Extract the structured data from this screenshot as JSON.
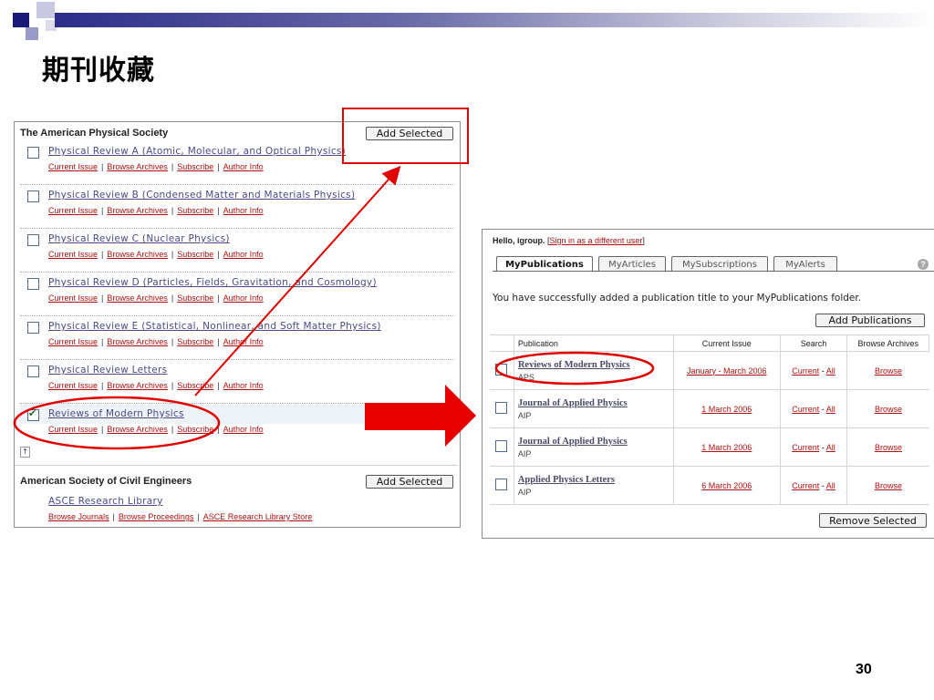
{
  "slide": {
    "title": "期刊收藏",
    "page_number": "30"
  },
  "left": {
    "society1": "The American Physical Society",
    "add_selected": "Add Selected",
    "journals": [
      {
        "title": "Physical Review A (Atomic, Molecular, and Optical Physics)",
        "checked": false
      },
      {
        "title": "Physical Review B (Condensed Matter and Materials Physics)",
        "checked": false
      },
      {
        "title": "Physical Review C (Nuclear Physics)",
        "checked": false
      },
      {
        "title": "Physical Review D (Particles, Fields, Gravitation, and Cosmology)",
        "checked": false
      },
      {
        "title": "Physical Review E (Statistical, Nonlinear, and Soft Matter Physics)",
        "checked": false
      },
      {
        "title": "Physical Review Letters",
        "checked": false
      },
      {
        "title": "Reviews of Modern Physics",
        "checked": true
      }
    ],
    "links": {
      "current": "Current Issue",
      "browse": "Browse Archives",
      "subscribe": "Subscribe",
      "author": "Author Info"
    },
    "top_icon": "up-arrow-icon",
    "society2": "American Society of Civil Engineers",
    "asce_title": "ASCE Research Library",
    "asce_links": {
      "journals": "Browse Journals",
      "proceedings": "Browse Proceedings",
      "store": "ASCE Research Library Store"
    }
  },
  "right": {
    "hello_prefix": "Hello, igroup.",
    "sign_in": "Sign in as a different user",
    "tabs": [
      "MyPublications",
      "MyArticles",
      "MySubscriptions",
      "MyAlerts"
    ],
    "message": "You have successfully added a publication title to your MyPublications folder.",
    "add_publications": "Add Publications",
    "columns": [
      "Publication",
      "Current Issue",
      "Search",
      "Browse Archives"
    ],
    "rows": [
      {
        "name": "Reviews of Modern Physics",
        "publisher": "APS",
        "issue": "January - March 2006"
      },
      {
        "name": "Journal of Applied Physics",
        "publisher": "AIP",
        "issue": "1 March 2006"
      },
      {
        "name": "Journal of Applied Physics",
        "publisher": "AIP",
        "issue": "1 March 2006"
      },
      {
        "name": "Applied Physics Letters",
        "publisher": "AIP",
        "issue": "6 March 2006"
      }
    ],
    "search_current": "Current",
    "search_dash": "-",
    "search_all": "All",
    "browse": "Browse",
    "remove_selected": "Remove Selected"
  },
  "colors": {
    "annotation": "#e00000",
    "link": "#b01010"
  }
}
